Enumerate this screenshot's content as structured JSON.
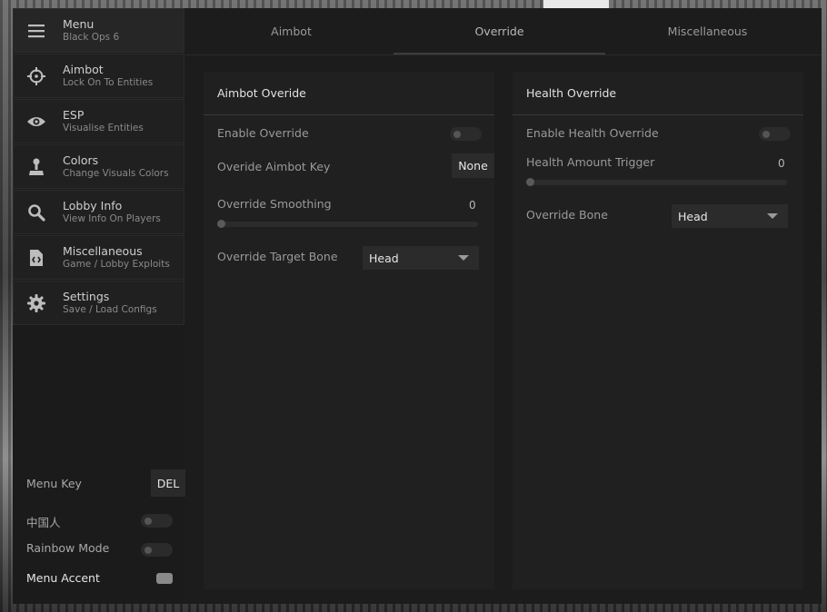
{
  "sidebar": {
    "header": {
      "title": "Menu",
      "subtitle": "Black Ops 6",
      "icon": "hamburger-icon"
    },
    "items": [
      {
        "title": "Aimbot",
        "subtitle": "Lock On To Entities",
        "icon": "crosshair-icon"
      },
      {
        "title": "ESP",
        "subtitle": "Visualise Entities",
        "icon": "eye-icon"
      },
      {
        "title": "Colors",
        "subtitle": "Change Visuals Colors",
        "icon": "paint-icon"
      },
      {
        "title": "Lobby Info",
        "subtitle": "View Info On Players",
        "icon": "search-icon"
      },
      {
        "title": "Miscellaneous",
        "subtitle": "Game / Lobby Exploits",
        "icon": "code-file-icon"
      },
      {
        "title": "Settings",
        "subtitle": "Save / Load Configs",
        "icon": "gear-icon"
      }
    ],
    "menu_key": {
      "label": "Menu Key",
      "value": "DEL"
    },
    "chinese": {
      "label": "中国人",
      "enabled": false
    },
    "rainbow": {
      "label": "Rainbow Mode",
      "enabled": false
    },
    "accent": {
      "label": "Menu Accent",
      "color": "#8a8a8a"
    }
  },
  "tabs": [
    {
      "label": "Aimbot",
      "active": false
    },
    {
      "label": "Override",
      "active": true
    },
    {
      "label": "Miscellaneous",
      "active": false
    }
  ],
  "aimbot_override": {
    "title": "Aimbot Overide",
    "enable": {
      "label": "Enable Override",
      "enabled": false
    },
    "key": {
      "label": "Overide Aimbot Key",
      "value": "None"
    },
    "smoothing": {
      "label": "Override Smoothing",
      "value": "0",
      "level": 0
    },
    "target_bone": {
      "label": "Override Target Bone",
      "value": "Head"
    }
  },
  "health_override": {
    "title": "Health Override",
    "enable": {
      "label": "Enable Health Override",
      "enabled": false
    },
    "trigger": {
      "label": "Health Amount Trigger",
      "value": "0",
      "level": 0
    },
    "bone": {
      "label": "Override Bone",
      "value": "Head"
    }
  }
}
